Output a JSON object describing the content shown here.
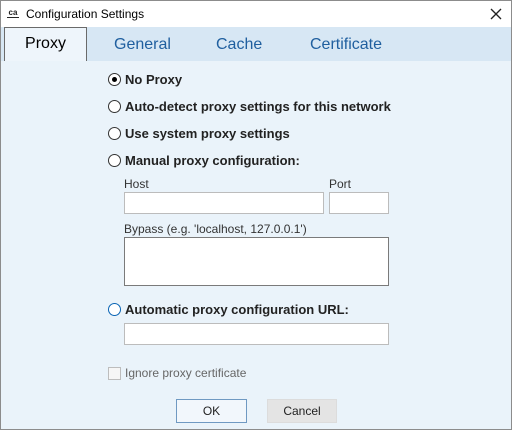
{
  "window": {
    "title": "Configuration Settings",
    "app_icon": "ca-logo-icon",
    "close_icon": "close-icon"
  },
  "tabs": [
    {
      "label": "Proxy",
      "active": true
    },
    {
      "label": "General",
      "active": false
    },
    {
      "label": "Cache",
      "active": false
    },
    {
      "label": "Certificate",
      "active": false
    }
  ],
  "proxy_options": [
    {
      "label": "No Proxy",
      "selected": true
    },
    {
      "label": "Auto-detect proxy settings for this network",
      "selected": false
    },
    {
      "label": "Use system proxy settings",
      "selected": false
    },
    {
      "label": "Manual proxy configuration:",
      "selected": false
    },
    {
      "label": "Automatic proxy configuration URL:",
      "selected": false
    }
  ],
  "manual": {
    "host_label": "Host",
    "host_value": "",
    "port_label": "Port",
    "port_value": "",
    "bypass_label": "Bypass (e.g. 'localhost, 127.0.0.1')",
    "bypass_value": ""
  },
  "auto_url_value": "",
  "ignore_cert": {
    "label": "Ignore proxy certificate",
    "checked": false
  },
  "buttons": {
    "ok": "OK",
    "cancel": "Cancel"
  },
  "colors": {
    "tabbar": "#d7e7f4",
    "content": "#eaf3fa",
    "tab_text": "#1f5f9f",
    "accent": "#0a64b4"
  }
}
